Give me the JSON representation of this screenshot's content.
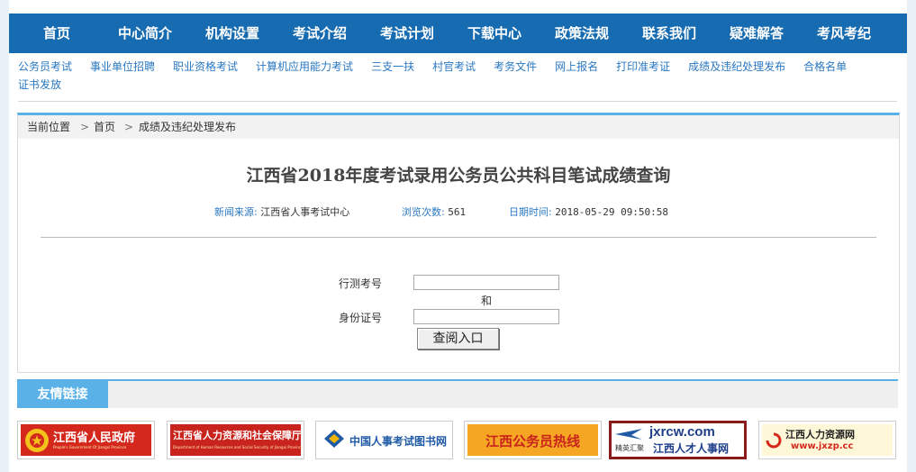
{
  "nav": [
    "首页",
    "中心简介",
    "机构设置",
    "考试介绍",
    "考试计划",
    "下载中心",
    "政策法规",
    "联系我们",
    "疑难解答",
    "考风考纪"
  ],
  "subnav": [
    "公务员考试",
    "事业单位招聘",
    "职业资格考试",
    "计算机应用能力考试",
    "三支一扶",
    "村官考试",
    "考务文件",
    "网上报名",
    "打印准考证",
    "成绩及违纪处理发布",
    "合格名单",
    "证书发放"
  ],
  "breadcrumb": {
    "label": "当前位置",
    "sep": ">",
    "home": "首页",
    "current": "成绩及违纪处理发布"
  },
  "article": {
    "title": "江西省2018年度考试录用公务员公共科目笔试成绩查询",
    "source_label": "新闻来源:",
    "source": "江西省人事考试中心",
    "views_label": "浏览次数:",
    "views": "561",
    "date_label": "日期时间:",
    "date": "2018-05-29 09:50:58"
  },
  "form": {
    "exam_no_label": "行测考号",
    "and_label": "和",
    "id_label": "身份证号",
    "exam_no_value": "",
    "id_value": "",
    "submit_label": "查阅入口"
  },
  "friend_links": {
    "title": "友情链接",
    "items": [
      {
        "name": "江西省人民政府",
        "sub": "People's Government Of Jiangxi Province"
      },
      {
        "name": "江西省人力资源和社会保障厅",
        "sub": "Department of Human Resources and Social Security of Jiangxi Province"
      },
      {
        "name": "中国人事考试图书网"
      },
      {
        "name": "江西公务员热线"
      },
      {
        "name": "jxrcw.com",
        "sub": "江西人才人事网",
        "tag": "精英汇聚"
      },
      {
        "name": "江西人力资源网",
        "sub": "www.jxzp.cc"
      }
    ]
  },
  "colors": {
    "nav_bg": "#176bb0",
    "accent": "#5ab1e8",
    "link": "#2a78c2"
  }
}
